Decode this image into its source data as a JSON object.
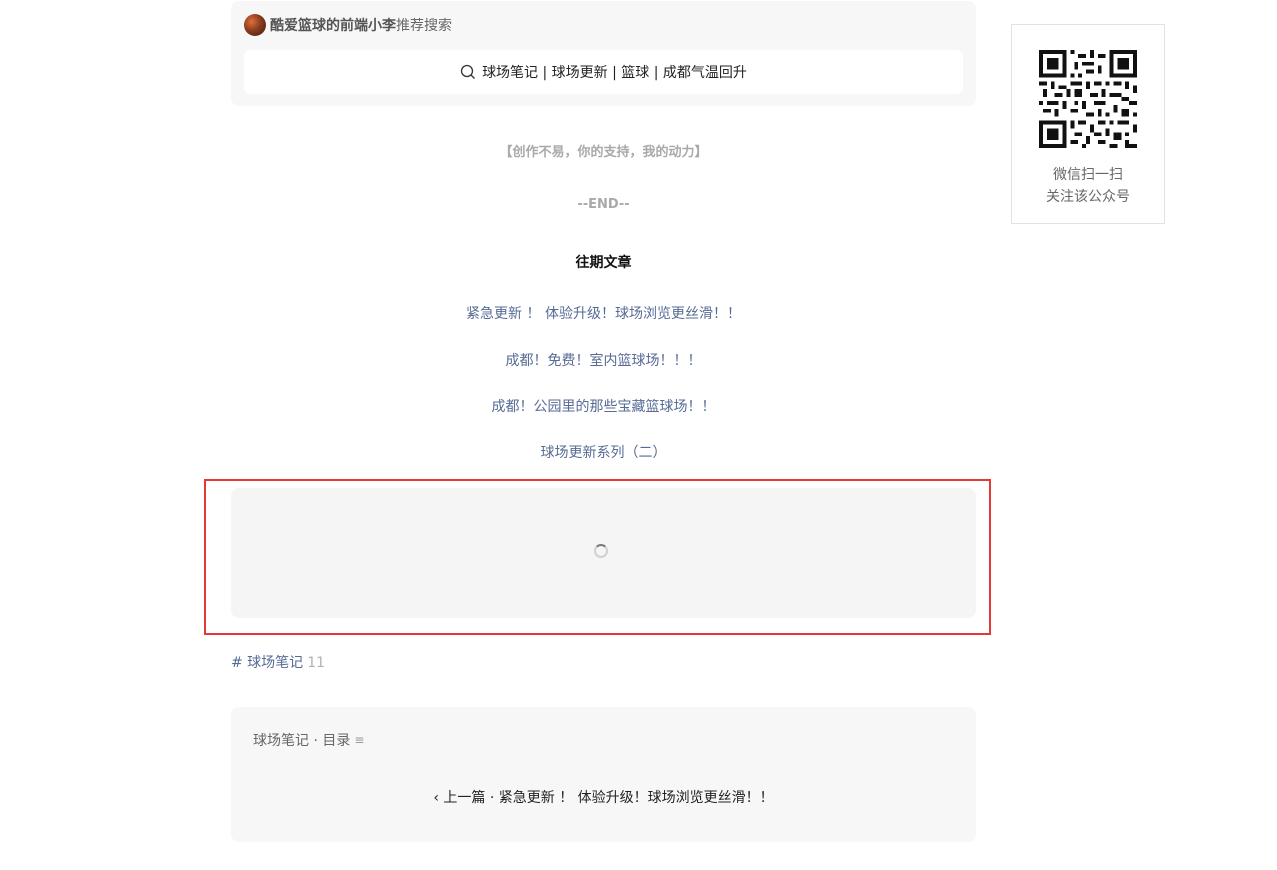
{
  "search_card": {
    "author": "酷爱篮球的前端小李",
    "suffix": "推荐搜索",
    "query": "球场笔记 | 球场更新 | 篮球 | 成都气温回升"
  },
  "article": {
    "quote": "【创作不易，你的支持，我的动力】",
    "end": "--END--",
    "past_title": "往期文章",
    "links": [
      "紧急更新 ！ 体验升级！球场浏览更丝滑！！",
      "成都！免费！室内篮球场！！！",
      "成都！公园里的那些宝藏篮球场！！",
      "球场更新系列（二）"
    ]
  },
  "tag": {
    "label": "# 球场笔记",
    "count": "11"
  },
  "toc": {
    "title": "球场笔记 · 目录",
    "menu_icon": "≡",
    "prev": "‹ 上一篇 · 紧急更新 ！ 体验升级！球场浏览更丝滑！！"
  },
  "qr": {
    "line1": "微信扫一扫",
    "line2": "关注该公众号"
  },
  "colors": {
    "link": "#576b95",
    "highlight": "#e53935",
    "card_bg": "#f7f7f7"
  }
}
